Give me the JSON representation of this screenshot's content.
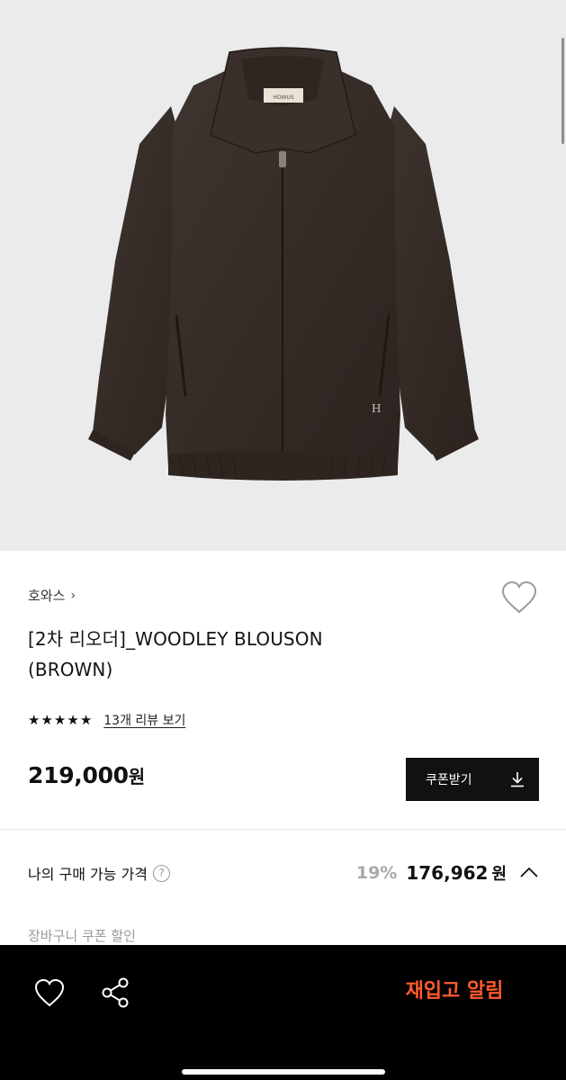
{
  "product": {
    "image_alt": "WOODLEY BLOUSON brown leather jacket",
    "label_tag": "HOWUS",
    "brand": "호와스",
    "title_line1": "[2차 리오더]_WOODLEY BLOUSON",
    "title_line2": "(BROWN)",
    "rating_stars": 5,
    "review_link": "13개 리뷰 보기",
    "price_value": "219,000",
    "price_unit": "원",
    "coupon_button": "쿠폰받기"
  },
  "my_price": {
    "label": "나의 구매 가능 가격",
    "help_glyph": "?",
    "discount": "19%",
    "price": "176,962",
    "unit": "원"
  },
  "cart_coupon_label": "장바구니 쿠폰 할인",
  "bottom_bar": {
    "restock_button": "재입고 알림"
  },
  "colors": {
    "accent": "#ff5b2e",
    "jacket": "#3a302b",
    "bottom_bar": "#000000"
  },
  "icons": [
    "chevron-right-icon",
    "heart-outline-icon",
    "star-icon",
    "download-icon",
    "question-icon",
    "chevron-up-icon",
    "share-icon"
  ]
}
